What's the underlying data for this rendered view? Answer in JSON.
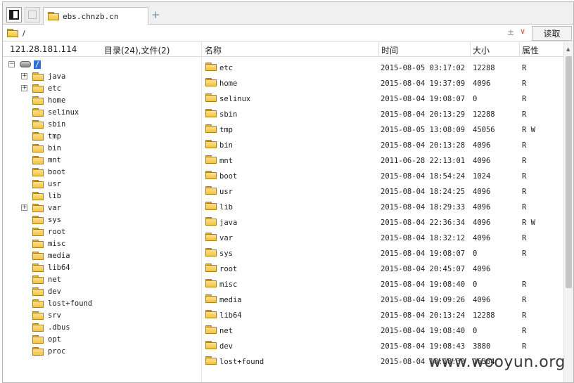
{
  "tab": {
    "title": "ebs.chnzb.cn",
    "add": "+"
  },
  "address": {
    "path": "/",
    "plusminus": "±",
    "dropdown": "∨",
    "read_button": "读取"
  },
  "header": {
    "ip": "121.28.181.114",
    "summary": "目录(24),文件(2)",
    "col_name": "名称",
    "col_time": "时间",
    "col_size": "大小",
    "col_attr": "属性"
  },
  "tree": {
    "root": "/",
    "items": [
      {
        "name": "java",
        "expand": "+"
      },
      {
        "name": "etc",
        "expand": "+"
      },
      {
        "name": "home",
        "expand": ""
      },
      {
        "name": "selinux",
        "expand": ""
      },
      {
        "name": "sbin",
        "expand": ""
      },
      {
        "name": "tmp",
        "expand": ""
      },
      {
        "name": "bin",
        "expand": ""
      },
      {
        "name": "mnt",
        "expand": ""
      },
      {
        "name": "boot",
        "expand": ""
      },
      {
        "name": "usr",
        "expand": ""
      },
      {
        "name": "lib",
        "expand": ""
      },
      {
        "name": "var",
        "expand": "+"
      },
      {
        "name": "sys",
        "expand": ""
      },
      {
        "name": "root",
        "expand": ""
      },
      {
        "name": "misc",
        "expand": ""
      },
      {
        "name": "media",
        "expand": ""
      },
      {
        "name": "lib64",
        "expand": ""
      },
      {
        "name": "net",
        "expand": ""
      },
      {
        "name": "dev",
        "expand": ""
      },
      {
        "name": "lost+found",
        "expand": ""
      },
      {
        "name": "srv",
        "expand": ""
      },
      {
        "name": ".dbus",
        "expand": ""
      },
      {
        "name": "opt",
        "expand": ""
      },
      {
        "name": "proc",
        "expand": ""
      }
    ]
  },
  "files": [
    {
      "name": "etc",
      "time": "2015-08-05 03:17:02",
      "size": "12288",
      "attr": "R"
    },
    {
      "name": "home",
      "time": "2015-08-04 19:37:09",
      "size": "4096",
      "attr": "R"
    },
    {
      "name": "selinux",
      "time": "2015-08-04 19:08:07",
      "size": "0",
      "attr": "R"
    },
    {
      "name": "sbin",
      "time": "2015-08-04 20:13:29",
      "size": "12288",
      "attr": "R"
    },
    {
      "name": "tmp",
      "time": "2015-08-05 13:08:09",
      "size": "45056",
      "attr": "R W"
    },
    {
      "name": "bin",
      "time": "2015-08-04 20:13:28",
      "size": "4096",
      "attr": "R"
    },
    {
      "name": "mnt",
      "time": "2011-06-28 22:13:01",
      "size": "4096",
      "attr": "R"
    },
    {
      "name": "boot",
      "time": "2015-08-04 18:54:24",
      "size": "1024",
      "attr": "R"
    },
    {
      "name": "usr",
      "time": "2015-08-04 18:24:25",
      "size": "4096",
      "attr": "R"
    },
    {
      "name": "lib",
      "time": "2015-08-04 18:29:33",
      "size": "4096",
      "attr": "R"
    },
    {
      "name": "java",
      "time": "2015-08-04 22:36:34",
      "size": "4096",
      "attr": "R W"
    },
    {
      "name": "var",
      "time": "2015-08-04 18:32:12",
      "size": "4096",
      "attr": "R"
    },
    {
      "name": "sys",
      "time": "2015-08-04 19:08:07",
      "size": "0",
      "attr": "R"
    },
    {
      "name": "root",
      "time": "2015-08-04 20:45:07",
      "size": "4096",
      "attr": ""
    },
    {
      "name": "misc",
      "time": "2015-08-04 19:08:40",
      "size": "0",
      "attr": "R"
    },
    {
      "name": "media",
      "time": "2015-08-04 19:09:26",
      "size": "4096",
      "attr": "R"
    },
    {
      "name": "lib64",
      "time": "2015-08-04 20:13:24",
      "size": "12288",
      "attr": "R"
    },
    {
      "name": "net",
      "time": "2015-08-04 19:08:40",
      "size": "0",
      "attr": "R"
    },
    {
      "name": "dev",
      "time": "2015-08-04 19:08:43",
      "size": "3880",
      "attr": "R"
    },
    {
      "name": "lost+found",
      "time": "2015-08-04 18:18:30",
      "size": "16384",
      "attr": ""
    }
  ],
  "watermark": "www.wooyun.org"
}
